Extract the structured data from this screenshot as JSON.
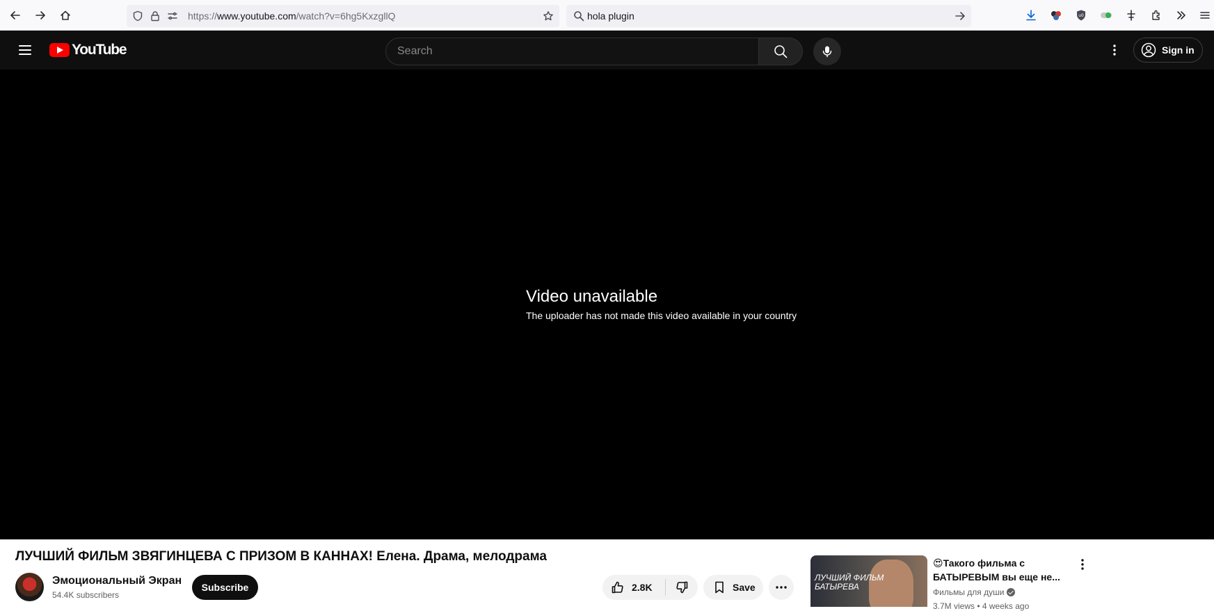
{
  "browser": {
    "url_scheme": "https://",
    "url_host": "www.youtube.com",
    "url_path": "/watch?v=6hg5KxzgllQ",
    "search_query": "hola plugin"
  },
  "youtube": {
    "logo_text": "YouTube",
    "search_placeholder": "Search",
    "sign_in_label": "Sign in"
  },
  "player": {
    "error_title": "Video unavailable",
    "error_subtitle": "The uploader has not made this video available in your country"
  },
  "video": {
    "title": "ЛУЧШИЙ ФИЛЬМ ЗВЯГИНЦЕВА С ПРИЗОМ В КАННАХ! Елена. Драма, мелодрама",
    "channel_name": "Эмоциональный Экран",
    "subscribers": "54.4K subscribers",
    "subscribe_label": "Subscribe",
    "like_count": "2.8K",
    "save_label": "Save"
  },
  "recommended": [
    {
      "title": "😍Такого фильма с БАТЫРЕВЫМ вы еще не...",
      "channel": "Фильмы для души",
      "verified": true,
      "meta": "3.7M views • 4 weeks ago",
      "thumbnail_text": "Лучший фильм Батырева"
    }
  ],
  "colors": {
    "youtube_red": "#ff0000",
    "header_bg": "#0f0f0f",
    "player_bg": "#000000",
    "chip_bg": "#f2f2f2"
  }
}
